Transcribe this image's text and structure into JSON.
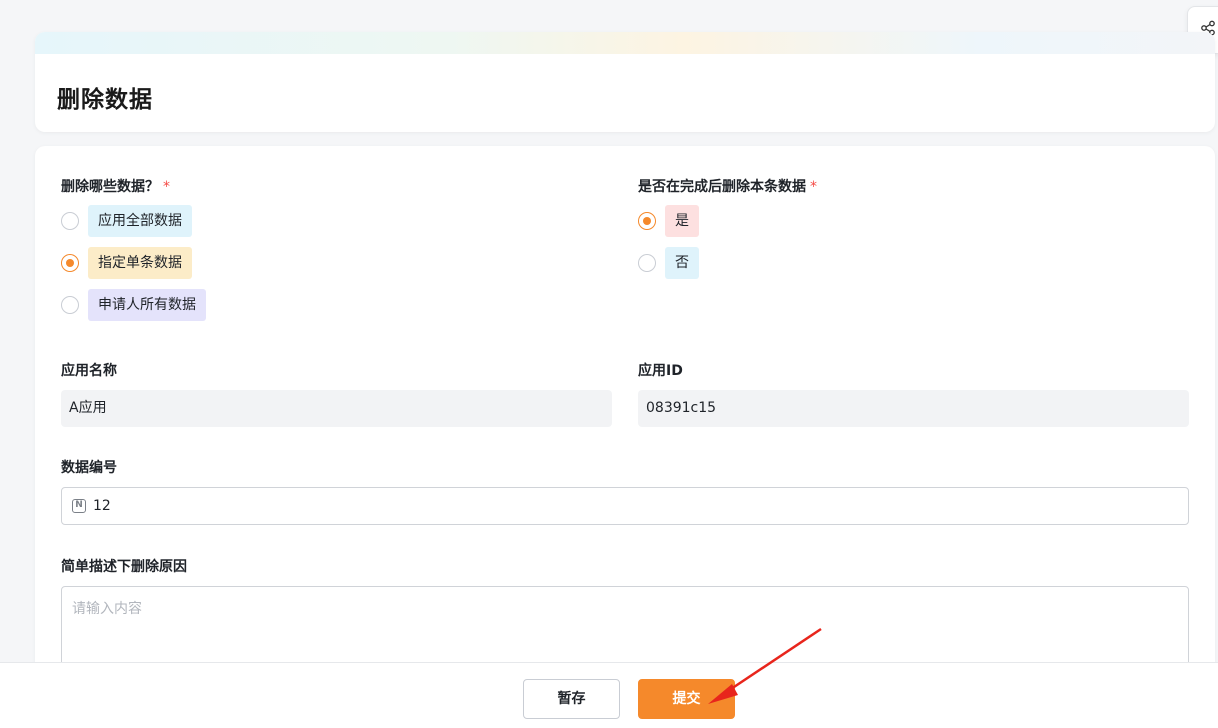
{
  "page": {
    "title": "删除数据"
  },
  "form": {
    "delete_scope": {
      "label": "删除哪些数据？",
      "required_mark": "*",
      "options": [
        {
          "label": "应用全部数据",
          "checked": false,
          "color": "#dff3fb"
        },
        {
          "label": "指定单条数据",
          "checked": true,
          "color": "#fcecc8"
        },
        {
          "label": "申请人所有数据",
          "checked": false,
          "color": "#e4e3fb"
        }
      ]
    },
    "delete_after": {
      "label": "是否在完成后删除本条数据",
      "required_mark": "*",
      "options": [
        {
          "label": "是",
          "checked": true,
          "color": "#fde0e0"
        },
        {
          "label": "否",
          "checked": false,
          "color": "#dff3fb"
        }
      ]
    },
    "app_name": {
      "label": "应用名称",
      "value": "A应用"
    },
    "app_id": {
      "label": "应用ID",
      "value": "08391c15"
    },
    "data_number": {
      "label": "数据编号",
      "value": "12",
      "icon": "number-icon"
    },
    "reason": {
      "label": "简单描述下删除原因",
      "placeholder": "请输入内容"
    }
  },
  "footer": {
    "save_label": "暂存",
    "submit_label": "提交"
  },
  "colors": {
    "accent": "#f5892b",
    "arrow": "#e8251c"
  },
  "icons": {
    "share": "share-icon",
    "annotation": "red-arrow-icon"
  }
}
